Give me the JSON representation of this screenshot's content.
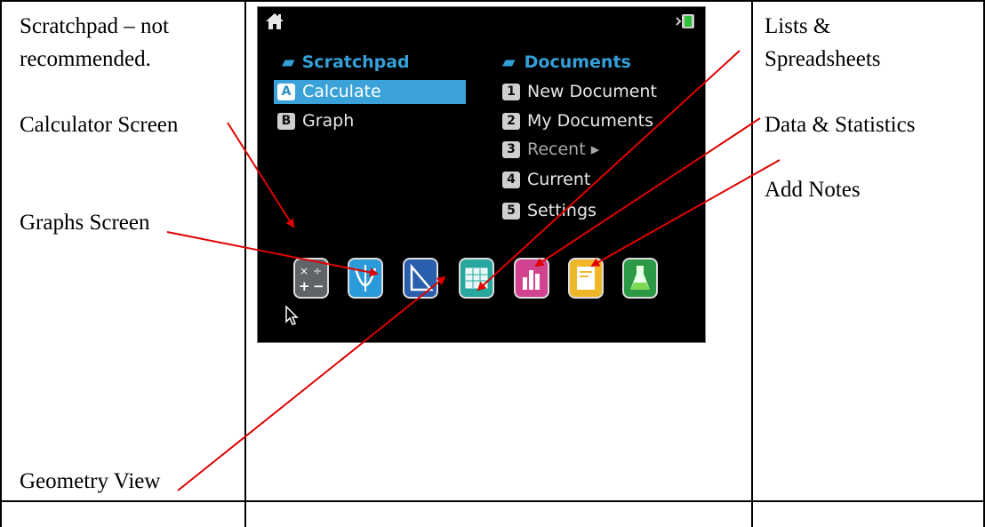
{
  "labels": {
    "scratchpad_line1": "Scratchpad – not",
    "scratchpad_line2": "recommended.",
    "calculator_screen": "Calculator Screen",
    "graphs_screen": "Graphs Screen",
    "geometry_view": "Geometry View",
    "lists_line1": "Lists &",
    "lists_line2": "Spreadsheets",
    "data_statistics": "Data & Statistics",
    "add_notes": "Add Notes"
  },
  "device": {
    "scratchpad_header": "Scratchpad",
    "documents_header": "Documents",
    "scratchpad_items": [
      {
        "key": "A",
        "label": "Calculate",
        "selected": true
      },
      {
        "key": "B",
        "label": "Graph",
        "selected": false
      }
    ],
    "document_items": [
      {
        "key": "1",
        "label": "New Document"
      },
      {
        "key": "2",
        "label": "My Documents"
      },
      {
        "key": "3",
        "label": "Recent ▸"
      },
      {
        "key": "4",
        "label": "Current"
      },
      {
        "key": "5",
        "label": "Settings"
      }
    ],
    "apps": [
      {
        "name": "calculator",
        "color": "#5f6468"
      },
      {
        "name": "graphs",
        "color": "#2a9bd8"
      },
      {
        "name": "geometry",
        "color": "#2a5fae"
      },
      {
        "name": "lists-spreadsheets",
        "color": "#27a79e"
      },
      {
        "name": "data-statistics",
        "color": "#d1428f"
      },
      {
        "name": "notes",
        "color": "#f0b62a"
      },
      {
        "name": "vernier",
        "color": "#2c9a44"
      }
    ]
  },
  "arrow_color": "#e00000"
}
